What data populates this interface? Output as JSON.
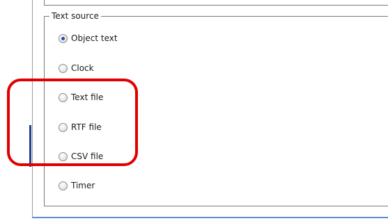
{
  "group": {
    "title": "Text source",
    "options": [
      {
        "label": "Object text",
        "checked": true
      },
      {
        "label": "Clock",
        "checked": false
      },
      {
        "label": "Text file",
        "checked": false
      },
      {
        "label": "RTF file",
        "checked": false
      },
      {
        "label": "CSV file",
        "checked": false
      },
      {
        "label": "Timer",
        "checked": false
      }
    ]
  },
  "highlight": {
    "color": "#e00000",
    "covers": [
      "Text file",
      "RTF file",
      "CSV file"
    ]
  }
}
